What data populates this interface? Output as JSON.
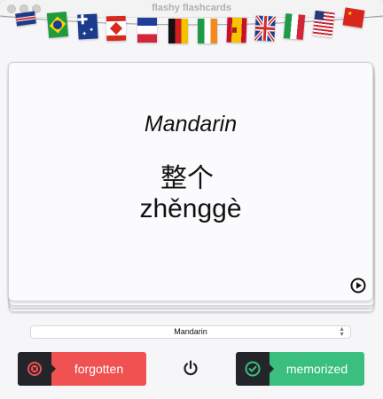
{
  "window": {
    "title": "flashy flashcards"
  },
  "banner": {
    "flags": [
      {
        "name": "united-kingdom-flag-icon"
      },
      {
        "name": "brazil-flag-icon"
      },
      {
        "name": "australia-flag-icon"
      },
      {
        "name": "canada-flag-icon"
      },
      {
        "name": "france-flag-icon"
      },
      {
        "name": "germany-flag-icon"
      },
      {
        "name": "ireland-flag-icon"
      },
      {
        "name": "spain-flag-icon"
      },
      {
        "name": "uk-union-jack-flag-icon"
      },
      {
        "name": "italy-flag-icon"
      },
      {
        "name": "united-states-flag-icon"
      },
      {
        "name": "china-flag-icon"
      }
    ]
  },
  "card": {
    "language": "Mandarin",
    "word": "整个",
    "pronunciation": "zhěnggè",
    "play_icon": "play-circle-icon"
  },
  "language_select": {
    "selected": "Mandarin"
  },
  "actions": {
    "forgotten_label": "forgotten",
    "forgotten_icon": "x-circle-icon",
    "memorized_label": "memorized",
    "memorized_icon": "check-circle-icon",
    "power_icon": "power-icon"
  },
  "colors": {
    "forgotten": "#f05252",
    "memorized": "#3bbf7e",
    "icon_panel": "#23252a",
    "card": "#fbfbfd"
  }
}
